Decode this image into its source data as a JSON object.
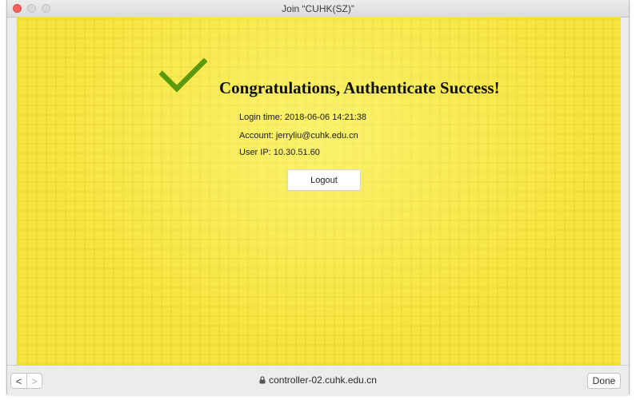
{
  "window": {
    "title": "Join “CUHK(SZ)”"
  },
  "page": {
    "heading": "Congratulations, Authenticate Success!",
    "login_time": "Login time: 2018-06-06 14:21:38",
    "account": "Account: jerryliu@cuhk.edu.cn",
    "user_ip": "User IP: 10.30.51.60",
    "logout_label": "Logout"
  },
  "bottom_bar": {
    "back_label": "<",
    "forward_label": ">",
    "url": "controller-02.cuhk.edu.cn",
    "done_label": "Done"
  },
  "colors": {
    "background": "#f6e43e",
    "checkmark": "#5a9a0a"
  },
  "icons": [
    "check-icon",
    "lock-icon",
    "chevron-left-icon",
    "chevron-right-icon"
  ]
}
